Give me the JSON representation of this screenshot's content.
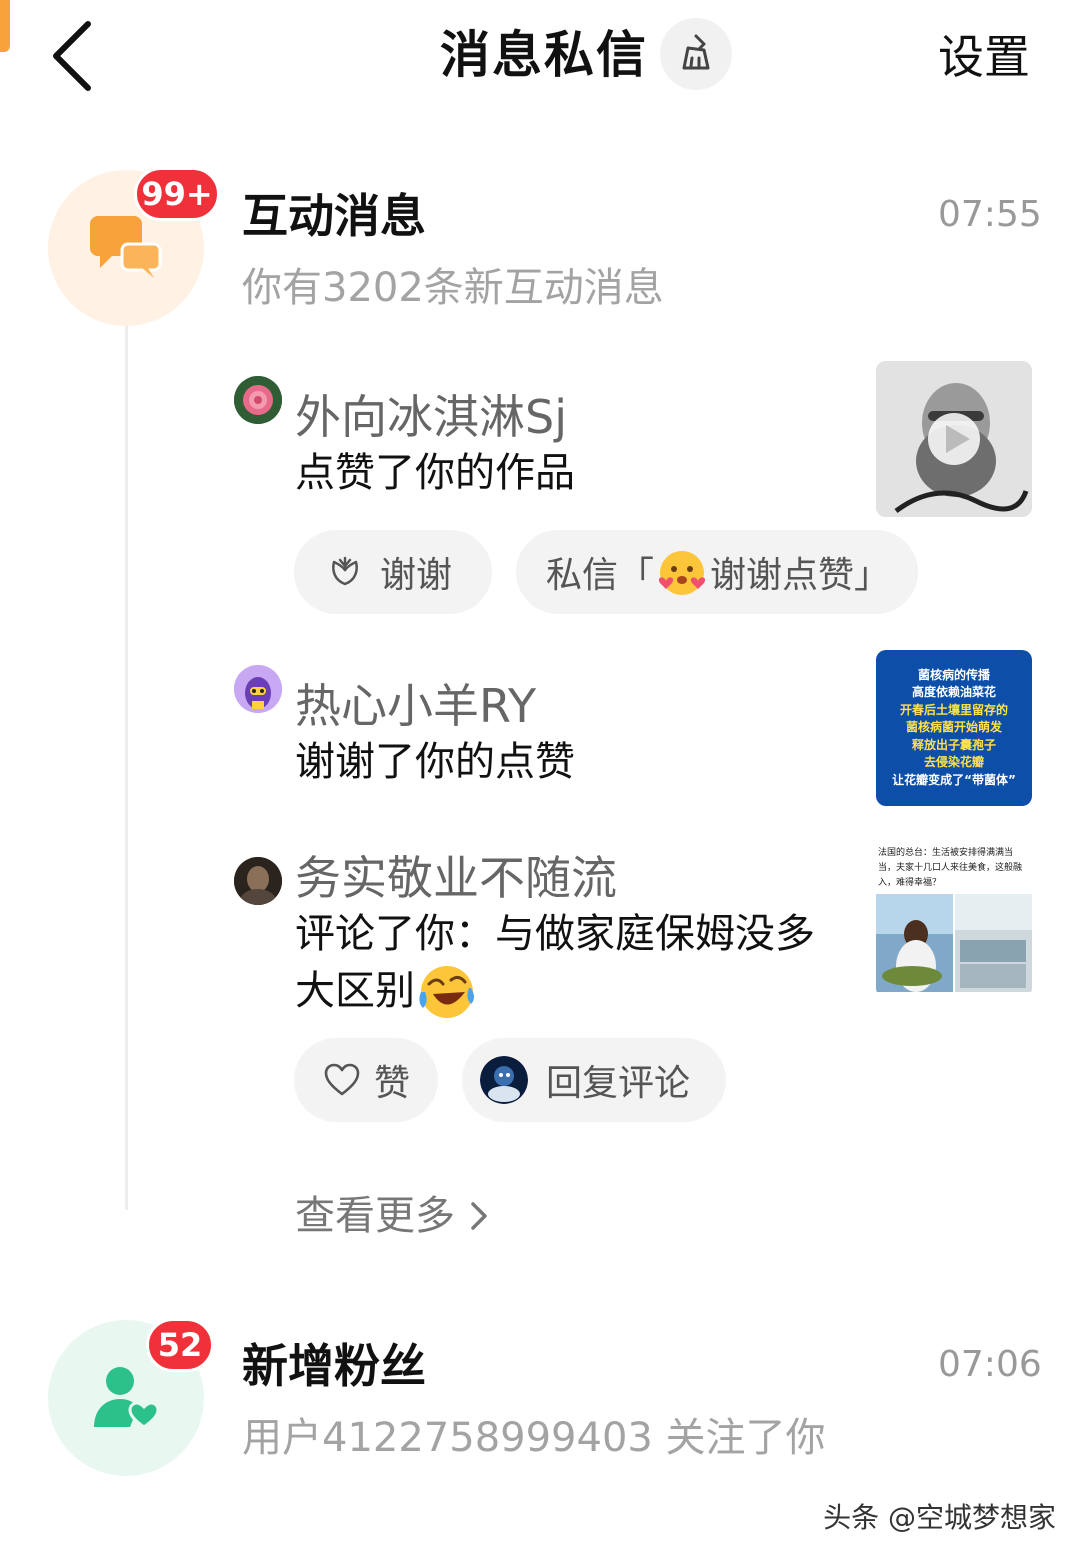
{
  "header": {
    "title": "消息私信",
    "settings_label": "设置"
  },
  "interactions": {
    "title": "互动消息",
    "time": "07:55",
    "subtitle": "你有3202条新互动消息",
    "badge": "99+",
    "items": [
      {
        "user": "外向冰淇淋Sj",
        "action": "点赞了你的作品",
        "buttons": {
          "thanks": "谢谢",
          "dm_prefix": "私信「",
          "dm_text": "谢谢点赞」"
        }
      },
      {
        "user": "热心小羊RY",
        "action": "谢谢了你的点赞",
        "thumb_lines": [
          "菌核病的传播",
          "高度依赖油菜花",
          "开春后土壤里留存的",
          "菌核病菌开始萌发",
          "释放出子囊孢子",
          "去侵染花瓣",
          "让花瓣变成了“带菌体”"
        ]
      },
      {
        "user": "务实敬业不随流",
        "action_line1": "评论了你：与做家庭保姆没多",
        "action_line2": "大区别",
        "buttons": {
          "like": "赞",
          "reply": "回复评论"
        },
        "thumb_caption": "法国的总台：生活被安排得满满当当，夫家十几口人来往美食，这般融入，难得幸福？"
      }
    ],
    "see_more": "查看更多"
  },
  "followers": {
    "title": "新增粉丝",
    "time": "07:06",
    "subtitle": "用户4122758999403 关注了你",
    "badge": "52"
  },
  "watermark": "头条 @空城梦想家",
  "colors": {
    "badge_red": "#f0313a",
    "interaction_bg": "#fff1e4",
    "interaction_icon": "#f7a23b",
    "follower_bg": "#e8f8f1",
    "follower_icon": "#2cc08a",
    "thumb_blue": "#0c4ea8"
  }
}
